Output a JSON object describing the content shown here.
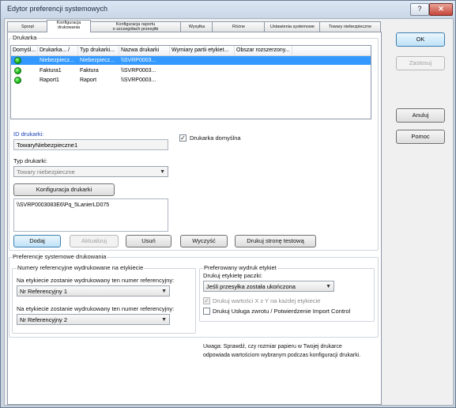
{
  "window": {
    "title": "Edytor preferencji systemowych",
    "help_label": "?",
    "close_label": "✕"
  },
  "tabs": [
    {
      "label": "Sprzęt"
    },
    {
      "label": "Konfiguracja drukowania",
      "l1": "Konfiguracja",
      "l2": "drukowania"
    },
    {
      "label": "Konfiguracja raportu o szczegółach przesyłki",
      "l1": "Konfiguracja raportu",
      "l2": "o szczegółach przesyłki"
    },
    {
      "label": "Wysyłka"
    },
    {
      "label": "Różne"
    },
    {
      "label": "Ustawienia systemowe"
    },
    {
      "label": "Towary niebezpieczne"
    }
  ],
  "right_buttons": {
    "ok": "OK",
    "apply": "Zastosuj",
    "cancel": "Anuluj",
    "help": "Pomoc"
  },
  "printers": {
    "group_label": "Drukarka",
    "columns": [
      "Domyśl...",
      "Drukarka... /",
      "Typ drukarki...",
      "Nazwa drukarki",
      "Wymiary partii etykiet...",
      "Obszar rozszerzony..."
    ],
    "rows": [
      {
        "name": "Niebezpiecz...",
        "type": "Niebezpiecz...",
        "device": "\\\\SVRP0003...",
        "selected": true
      },
      {
        "name": "Faktura1",
        "type": "Faktura",
        "device": "\\\\SVRP0003...",
        "selected": false
      },
      {
        "name": "Raport1",
        "type": "Raport",
        "device": "\\\\SVRP0003...",
        "selected": false
      }
    ]
  },
  "printer_form": {
    "id_label": "ID drukarki:",
    "id_value": "TowaryNiebezpieczne1",
    "default_label": "Drukarka domyślna",
    "default_checked": true,
    "type_label": "Typ drukarki:",
    "type_value": "Towary niebezpieczne",
    "config_button": "Konfiguracja drukarki",
    "path_value": "\\\\SVRP0003083E6\\Pq_5LanierLD075"
  },
  "actions": {
    "add": "Dodaj",
    "update": "Aktualizuj",
    "remove": "Usuń",
    "clear": "Wyczyść",
    "test": "Drukuj stronę testową"
  },
  "system_prefs": {
    "group_label": "Preferencje systemowe drukowania",
    "ref_group_label": "Numery referencyjne wydrukowane na etykiecie",
    "ref1_label": "Na etykiecie zostanie wydrukowany ten numer referencyjny:",
    "ref1_value": "Nr Referencyjny 1",
    "ref2_label": "Na etykiecie zostanie wydrukowany ten numer referencyjny:",
    "ref2_value": "Nr Referencyjny 2",
    "label_group_label": "Preferowany wydruk etykiet",
    "print_label_label": "Drukuj etykietę paczki:",
    "print_label_value": "Jeśli przesyłka została ukończona",
    "chk1_label": "Drukuj wartości X z Y na każdej etykiecie",
    "chk1_checked": true,
    "chk2_label": "Drukuj Usługa zwrotu / Potwierdzenie Import Control",
    "chk2_checked": false
  },
  "note": "Uwaga: Sprawdź, czy rozmiar papieru w Twojej drukarce odpowiada wartościom wybranym podczas konfiguracji drukarki."
}
